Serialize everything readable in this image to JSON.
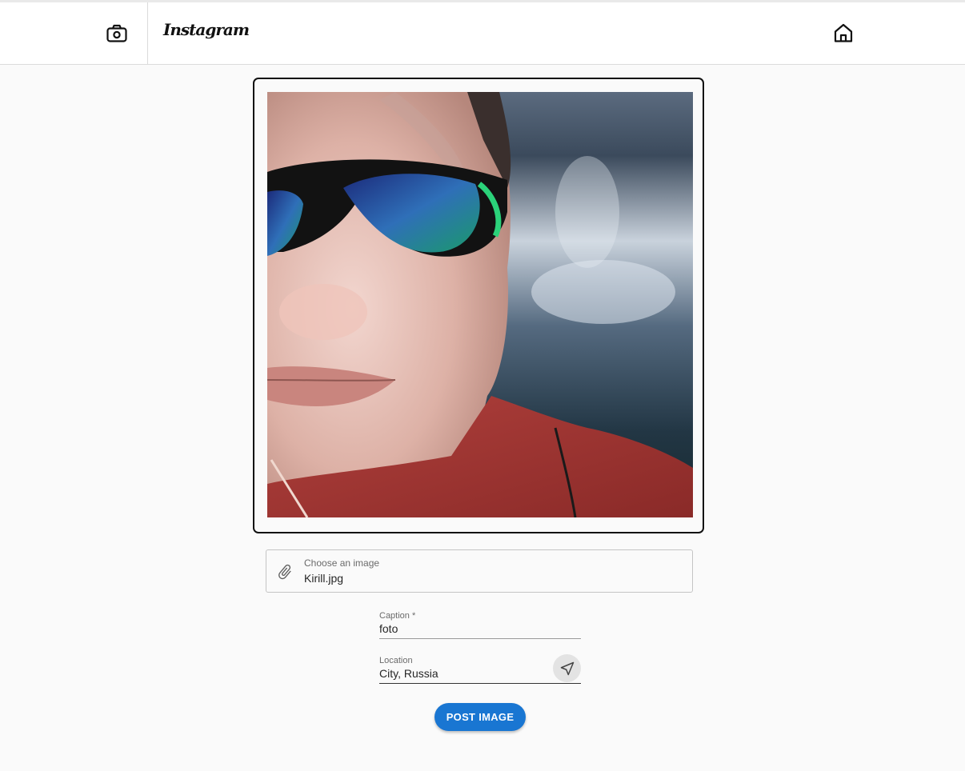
{
  "header": {
    "logo_text": "Instagram",
    "camera_icon": "camera-icon",
    "home_icon": "home-icon"
  },
  "preview": {
    "photo": "portrait selfie with mirrored sunglasses, red sweater, lake background"
  },
  "file_input": {
    "label": "Choose an image",
    "value": "Kirill.jpg",
    "icon": "paperclip-icon"
  },
  "caption": {
    "label": "Caption *",
    "value": "foto"
  },
  "location": {
    "label": "Location",
    "value": "City, Russia",
    "icon": "navigation-arrow-icon"
  },
  "submit": {
    "label": "POST IMAGE"
  },
  "colors": {
    "accent": "#1976d2",
    "background": "#fafafa",
    "header_bg": "#ffffff"
  }
}
